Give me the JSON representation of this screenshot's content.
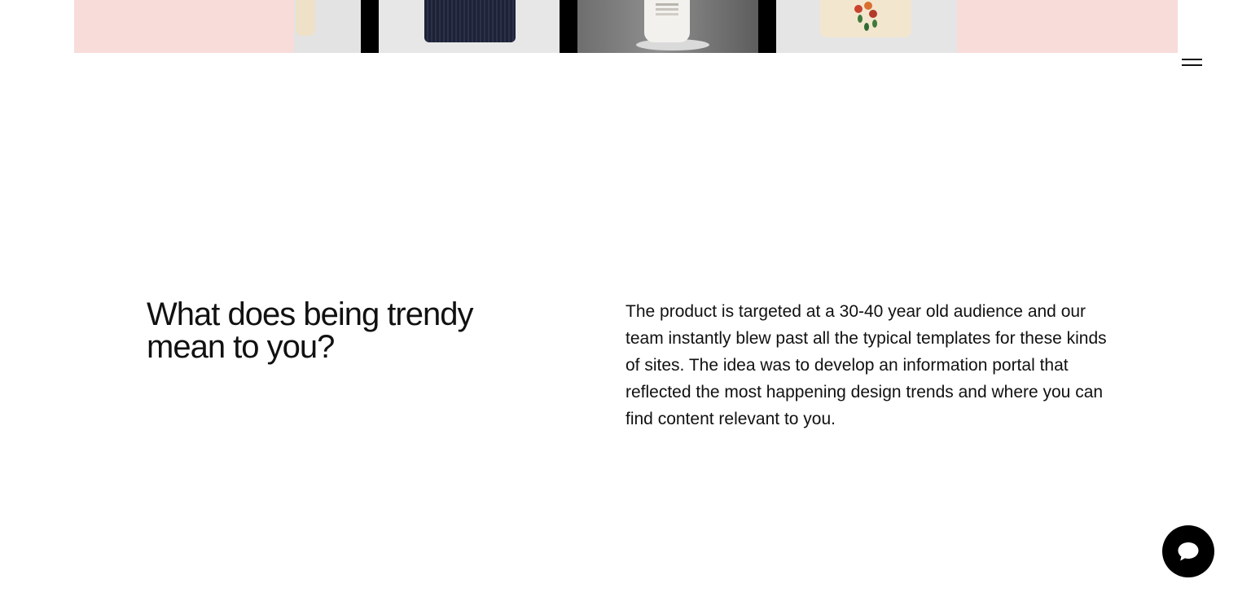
{
  "nav": {
    "menu_icon": "hamburger-menu-icon"
  },
  "hero": {
    "background_color": "#f7dcda",
    "images": [
      {
        "name": "lotion-tube-image"
      },
      {
        "name": "knit-scarf-fringe-image"
      },
      {
        "name": "lotion-bottle-image"
      },
      {
        "name": "floral-pouch-image"
      }
    ]
  },
  "section": {
    "heading": "What does being trendy mean to you?",
    "body": "The product is targeted at a 30-40 year old audience and our team instantly blew past all the typical templates for these kinds of sites. The idea was to develop an information portal that reflected the most happening design trends and where you can find content relevant to you."
  },
  "chat": {
    "icon": "chat-bubble-icon",
    "button_color": "#000000"
  }
}
